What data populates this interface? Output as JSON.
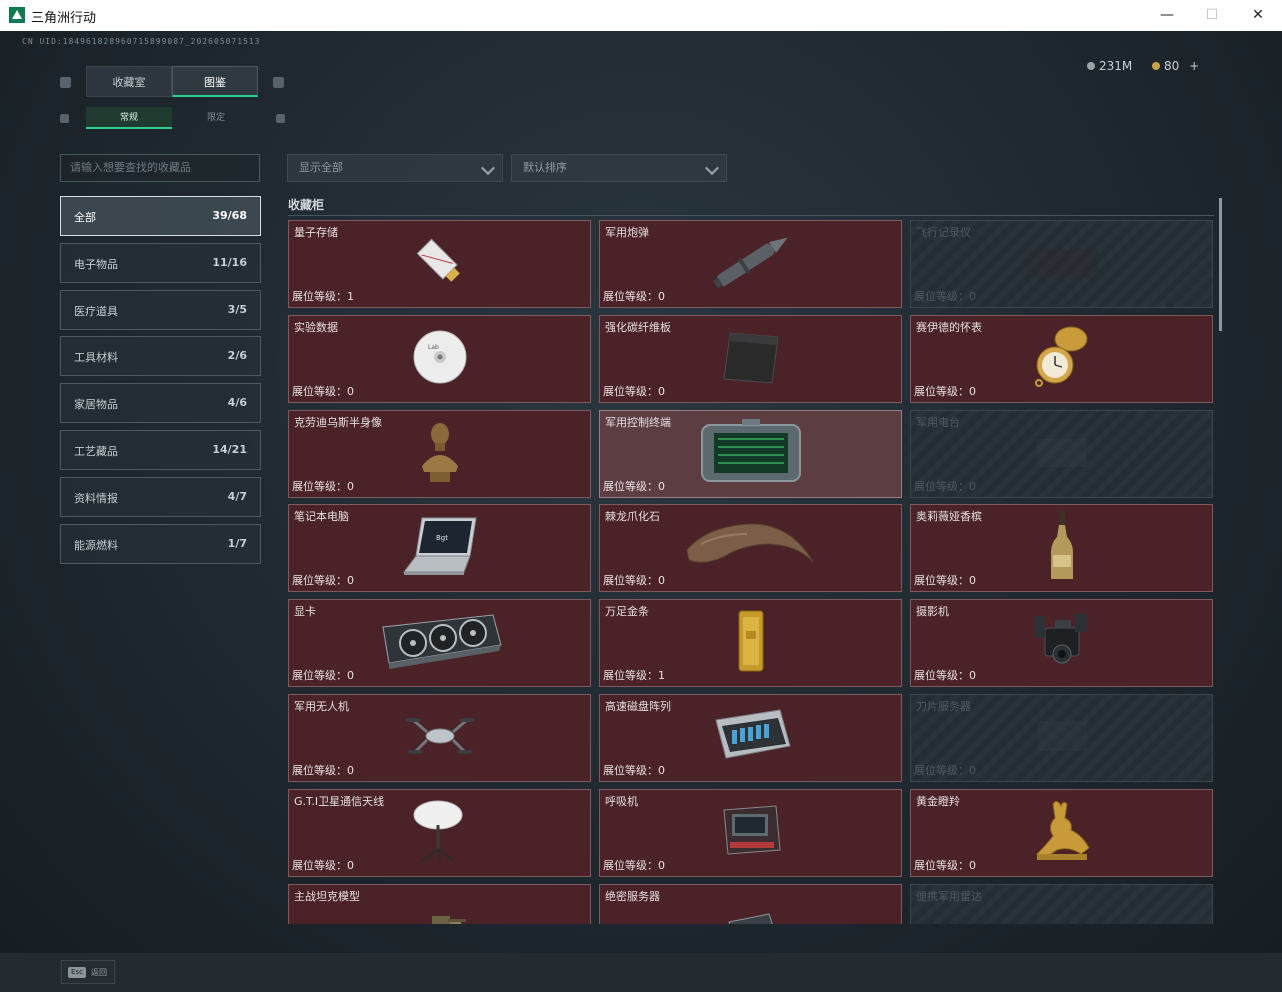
{
  "window": {
    "title": "三角洲行动",
    "minimize": "—",
    "maximize": "☐",
    "close": "✕"
  },
  "header": {
    "uid": "CN UID:184961828960715899087_202605071513",
    "currency_a": "231M",
    "currency_b": "80",
    "add": "+",
    "tabs": [
      {
        "label": "收藏室"
      },
      {
        "label": "图鉴"
      }
    ],
    "subtabs": [
      {
        "label": "常规"
      },
      {
        "label": "限定"
      }
    ]
  },
  "filters": {
    "search_placeholder": "请输入想要查找的收藏品",
    "show_all": "显示全部",
    "sort": "默认排序"
  },
  "categories": [
    {
      "label": "全部",
      "count": "39/68"
    },
    {
      "label": "电子物品",
      "count": "11/16"
    },
    {
      "label": "医疗道具",
      "count": "3/5"
    },
    {
      "label": "工具材料",
      "count": "2/6"
    },
    {
      "label": "家居物品",
      "count": "4/6"
    },
    {
      "label": "工艺藏品",
      "count": "14/21"
    },
    {
      "label": "资料情报",
      "count": "4/7"
    },
    {
      "label": "能源燃料",
      "count": "1/7"
    }
  ],
  "section": {
    "title": "收藏柜"
  },
  "items": [
    {
      "name": "量子存储",
      "level": "展位等级：1",
      "icon": "usb-drive-icon",
      "locked": false
    },
    {
      "name": "军用炮弹",
      "level": "展位等级：0",
      "icon": "artillery-shell-icon",
      "locked": false
    },
    {
      "name": "飞行记录仪",
      "level": "展位等级：0",
      "icon": "flight-recorder-icon",
      "locked": true
    },
    {
      "name": "实验数据",
      "level": "展位等级：0",
      "icon": "disc-icon",
      "locked": false
    },
    {
      "name": "强化碳纤维板",
      "level": "展位等级：0",
      "icon": "carbon-plate-icon",
      "locked": false
    },
    {
      "name": "赛伊德的怀表",
      "level": "展位等级：0",
      "icon": "pocket-watch-icon",
      "locked": false
    },
    {
      "name": "克劳迪乌斯半身像",
      "level": "展位等级：0",
      "icon": "bust-icon",
      "locked": false
    },
    {
      "name": "军用控制终端",
      "level": "展位等级：0",
      "icon": "control-terminal-icon",
      "locked": false,
      "highlight": true
    },
    {
      "name": "军用电台",
      "level": "展位等级：0",
      "icon": "radio-icon",
      "locked": true
    },
    {
      "name": "笔记本电脑",
      "level": "展位等级：0",
      "icon": "laptop-icon",
      "locked": false
    },
    {
      "name": "棘龙爪化石",
      "level": "展位等级：0",
      "icon": "claw-fossil-icon",
      "locked": false
    },
    {
      "name": "奥莉薇娅香槟",
      "level": "展位等级：0",
      "icon": "champagne-icon",
      "locked": false
    },
    {
      "name": "显卡",
      "level": "展位等级：0",
      "icon": "graphics-card-icon",
      "locked": false
    },
    {
      "name": "万足金条",
      "level": "展位等级：1",
      "icon": "gold-bar-icon",
      "locked": false
    },
    {
      "name": "摄影机",
      "level": "展位等级：0",
      "icon": "camera-icon",
      "locked": false
    },
    {
      "name": "军用无人机",
      "level": "展位等级：0",
      "icon": "drone-icon",
      "locked": false
    },
    {
      "name": "高速磁盘阵列",
      "level": "展位等级：0",
      "icon": "disk-array-icon",
      "locked": false
    },
    {
      "name": "刀片服务器",
      "level": "展位等级：0",
      "icon": "blade-server-icon",
      "locked": true
    },
    {
      "name": "G.T.I卫星通信天线",
      "level": "展位等级：0",
      "icon": "satellite-dish-icon",
      "locked": false
    },
    {
      "name": "呼吸机",
      "level": "展位等级：0",
      "icon": "ventilator-icon",
      "locked": false
    },
    {
      "name": "黄金瞪羚",
      "level": "展位等级：0",
      "icon": "gold-gazelle-icon",
      "locked": false
    },
    {
      "name": "主战坦克模型",
      "level": "",
      "icon": "tank-model-icon",
      "locked": false
    },
    {
      "name": "绝密服务器",
      "level": "",
      "icon": "secret-server-icon",
      "locked": false
    },
    {
      "name": "便携军用雷达",
      "level": "",
      "icon": "radar-icon",
      "locked": true
    }
  ],
  "footer": {
    "esc_key": "Esc",
    "back_label": "返回"
  }
}
